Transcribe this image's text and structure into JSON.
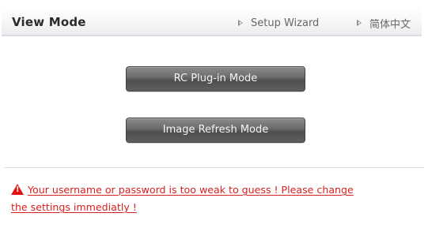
{
  "header": {
    "title": "View Mode",
    "links": [
      {
        "label": "Setup Wizard",
        "icon": "chevron-right-icon"
      },
      {
        "label": "简体中文",
        "icon": "chevron-right-icon"
      }
    ]
  },
  "buttons": {
    "rc_plugin": "RC Plug-in Mode",
    "image_refresh": "Image Refresh Mode"
  },
  "warning": {
    "icon": "warning-icon",
    "line1": "Your username or password is too weak to guess ! Please change",
    "line2": "the settings immediatly !"
  },
  "colors": {
    "warning_red": "#d82020",
    "button_dark": "#555555",
    "header_border": "#d7dbe3"
  }
}
